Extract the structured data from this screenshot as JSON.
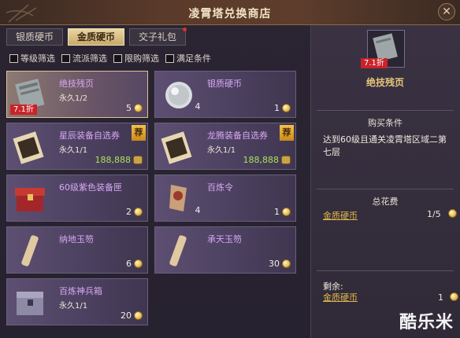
{
  "window": {
    "title": "凌霄塔兑换商店",
    "close_icon": "close-icon"
  },
  "tabs": [
    {
      "label": "银质硬币",
      "active": false
    },
    {
      "label": "金质硬币",
      "active": true
    },
    {
      "label": "交子礼包",
      "active": false,
      "has_dot": true
    }
  ],
  "filters": [
    "等级筛选",
    "流派筛选",
    "限购筛选",
    "满足条件"
  ],
  "items": [
    {
      "name": "绝技残页",
      "sub": "永久1/2",
      "qty": "",
      "price": "5",
      "currency": "coin",
      "badge": "7.1折",
      "recommended": false,
      "selected": true,
      "icon": "scroll-page-icon"
    },
    {
      "name": "银质硬币",
      "sub": "",
      "qty": "4",
      "price": "1",
      "currency": "coin",
      "badge": "",
      "recommended": false,
      "selected": false,
      "icon": "silver-coin-icon"
    },
    {
      "name": "星辰装备自选券",
      "sub": "永久1/1",
      "qty": "",
      "price": "188,888",
      "currency": "ticket",
      "badge": "",
      "recommended": true,
      "selected": false,
      "icon": "voucher-icon"
    },
    {
      "name": "龙腾装备自选券",
      "sub": "永久1/1",
      "qty": "",
      "price": "188,888",
      "currency": "ticket",
      "badge": "",
      "recommended": true,
      "selected": false,
      "icon": "voucher-icon"
    },
    {
      "name": "60级紫色装备匣",
      "sub": "",
      "qty": "",
      "price": "2",
      "currency": "coin",
      "badge": "",
      "recommended": false,
      "selected": false,
      "icon": "chest-icon"
    },
    {
      "name": "百炼令",
      "sub": "",
      "qty": "4",
      "price": "1",
      "currency": "coin",
      "badge": "",
      "recommended": false,
      "selected": false,
      "icon": "token-icon"
    },
    {
      "name": "纳地玉笏",
      "sub": "",
      "qty": "",
      "price": "6",
      "currency": "coin",
      "badge": "",
      "recommended": false,
      "selected": false,
      "icon": "jade-tablet-icon"
    },
    {
      "name": "承天玉笏",
      "sub": "",
      "qty": "",
      "price": "30",
      "currency": "coin",
      "badge": "",
      "recommended": false,
      "selected": false,
      "icon": "jade-tablet-icon"
    },
    {
      "name": "百炼神兵箱",
      "sub": "永久1/1",
      "qty": "",
      "price": "20",
      "currency": "coin",
      "badge": "",
      "recommended": false,
      "selected": false,
      "icon": "weapon-box-icon"
    }
  ],
  "detail": {
    "name": "绝技残页",
    "badge": "7.1折",
    "condition_title": "购买条件",
    "condition_text": "达到60级且通关凌霄塔区域二第七层",
    "cost_title": "总花费",
    "cost_currency": "金质硬币",
    "cost_value": "1/5",
    "remain_label": "剩余:",
    "remain_currency": "金质硬币",
    "remain_value": "1"
  },
  "watermark": "酷乐米",
  "colors": {
    "accent_gold": "#e2b84a",
    "item_name": "#d7a7f3",
    "badge_red": "#c9232a"
  }
}
